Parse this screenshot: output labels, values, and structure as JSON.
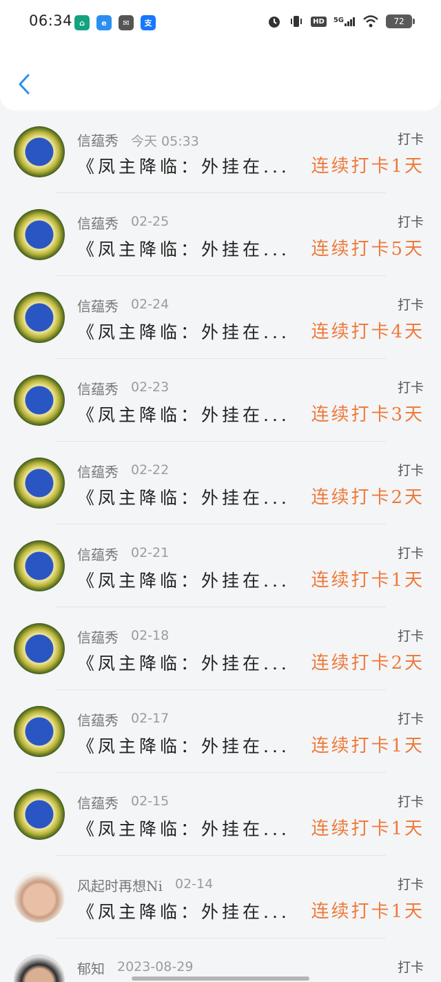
{
  "status_bar": {
    "time": "06:34",
    "app_icons": [
      {
        "name": "app-icon-home",
        "glyph": "⌂",
        "color": "#14a37f"
      },
      {
        "name": "app-icon-e",
        "glyph": "e",
        "color": "#2a8ff0"
      },
      {
        "name": "app-icon-mail",
        "glyph": "✉",
        "color": "#555555"
      },
      {
        "name": "app-icon-alipay",
        "glyph": "支",
        "color": "#1677ff"
      }
    ],
    "hd": "HD",
    "network": "5G",
    "battery": "72"
  },
  "header": {
    "back_icon": "chevron-left-icon",
    "accent": "#2a8ff0"
  },
  "items": [
    {
      "name": "信蕴秀",
      "date": "今天 05:33",
      "tag": "打卡",
      "title": "《凤主降临：外挂在...",
      "streak": "连续打卡1天",
      "avatar": "team-logo"
    },
    {
      "name": "信蕴秀",
      "date": "02-25",
      "tag": "打卡",
      "title": "《凤主降临：外挂在...",
      "streak": "连续打卡5天",
      "avatar": "team-logo"
    },
    {
      "name": "信蕴秀",
      "date": "02-24",
      "tag": "打卡",
      "title": "《凤主降临：外挂在...",
      "streak": "连续打卡4天",
      "avatar": "team-logo"
    },
    {
      "name": "信蕴秀",
      "date": "02-23",
      "tag": "打卡",
      "title": "《凤主降临：外挂在...",
      "streak": "连续打卡3天",
      "avatar": "team-logo"
    },
    {
      "name": "信蕴秀",
      "date": "02-22",
      "tag": "打卡",
      "title": "《凤主降临：外挂在...",
      "streak": "连续打卡2天",
      "avatar": "team-logo"
    },
    {
      "name": "信蕴秀",
      "date": "02-21",
      "tag": "打卡",
      "title": "《凤主降临：外挂在...",
      "streak": "连续打卡1天",
      "avatar": "team-logo"
    },
    {
      "name": "信蕴秀",
      "date": "02-18",
      "tag": "打卡",
      "title": "《凤主降临：外挂在...",
      "streak": "连续打卡2天",
      "avatar": "team-logo"
    },
    {
      "name": "信蕴秀",
      "date": "02-17",
      "tag": "打卡",
      "title": "《凤主降临：外挂在...",
      "streak": "连续打卡1天",
      "avatar": "team-logo"
    },
    {
      "name": "信蕴秀",
      "date": "02-15",
      "tag": "打卡",
      "title": "《凤主降临：外挂在...",
      "streak": "连续打卡1天",
      "avatar": "team-logo"
    },
    {
      "name": "风起时再想Ni",
      "date": "02-14",
      "tag": "打卡",
      "title": "《凤主降临：外挂在...",
      "streak": "连续打卡1天",
      "avatar": "photo"
    },
    {
      "name": "郁知",
      "date": "2023-08-29",
      "tag": "打卡",
      "title": "",
      "streak": "",
      "avatar": "photo2"
    }
  ]
}
